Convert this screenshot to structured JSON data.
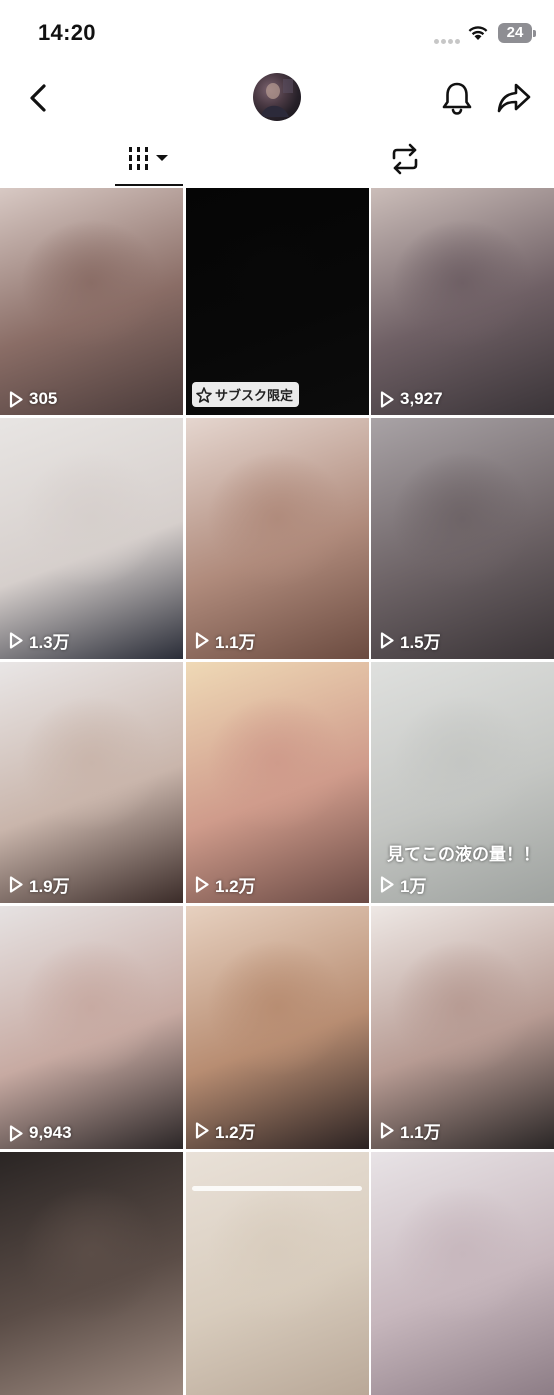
{
  "status_bar": {
    "time": "14:20",
    "battery": "24"
  },
  "nav": {
    "back_icon": "chevron-left-icon",
    "bell_icon": "bell-icon",
    "share_icon": "share-arrow-icon"
  },
  "tabs": [
    {
      "name": "videos-grid",
      "icon": "grid-bars-icon",
      "active": true
    },
    {
      "name": "reposts",
      "icon": "repost-icon",
      "active": false
    }
  ],
  "videos": [
    {
      "views": "305",
      "colors": [
        "#d8c9c4",
        "#8a6d66",
        "#4a3b3a"
      ]
    },
    {
      "views": "",
      "badge": "サブスク限定",
      "colors": [
        "#050505",
        "#080808",
        "#0c0c0c"
      ]
    },
    {
      "views": "3,927",
      "colors": [
        "#cbbdb9",
        "#6f6065",
        "#3a3438"
      ]
    },
    {
      "views": "1.3万",
      "colors": [
        "#e8e5e3",
        "#d6cfcc",
        "#2a2d38"
      ]
    },
    {
      "views": "1.1万",
      "colors": [
        "#e5d6cf",
        "#b08b7c",
        "#6b4b40"
      ]
    },
    {
      "views": "1.5万",
      "colors": [
        "#a9a3a6",
        "#6e6467",
        "#3a3437"
      ]
    },
    {
      "views": "1.9万",
      "colors": [
        "#e9e6e6",
        "#c9b5ab",
        "#3b2c29"
      ]
    },
    {
      "views": "1.2万",
      "colors": [
        "#efd9b6",
        "#cf9b8b",
        "#6a4a44"
      ]
    },
    {
      "views": "1万",
      "caption": "見てこの液の量！！",
      "colors": [
        "#dfe0de",
        "#c4c6c3",
        "#9ea29f"
      ]
    },
    {
      "views": "9,943",
      "colors": [
        "#e6e2e2",
        "#c7aaa2",
        "#2b2627"
      ]
    },
    {
      "views": "1.2万",
      "colors": [
        "#e7d1c0",
        "#b88d72",
        "#2b2222"
      ]
    },
    {
      "views": "1.1万",
      "colors": [
        "#eee8e5",
        "#b79b93",
        "#2a2626"
      ]
    },
    {
      "views": "",
      "colors": [
        "#2a2524",
        "#5b4d47",
        "#9d8a80"
      ]
    },
    {
      "views": "",
      "colors": [
        "#e9e1d8",
        "#d8ccbd",
        "#b9a898"
      ]
    },
    {
      "views": "",
      "colors": [
        "#e8e3e6",
        "#c7b7bd",
        "#8d7d86"
      ]
    }
  ]
}
